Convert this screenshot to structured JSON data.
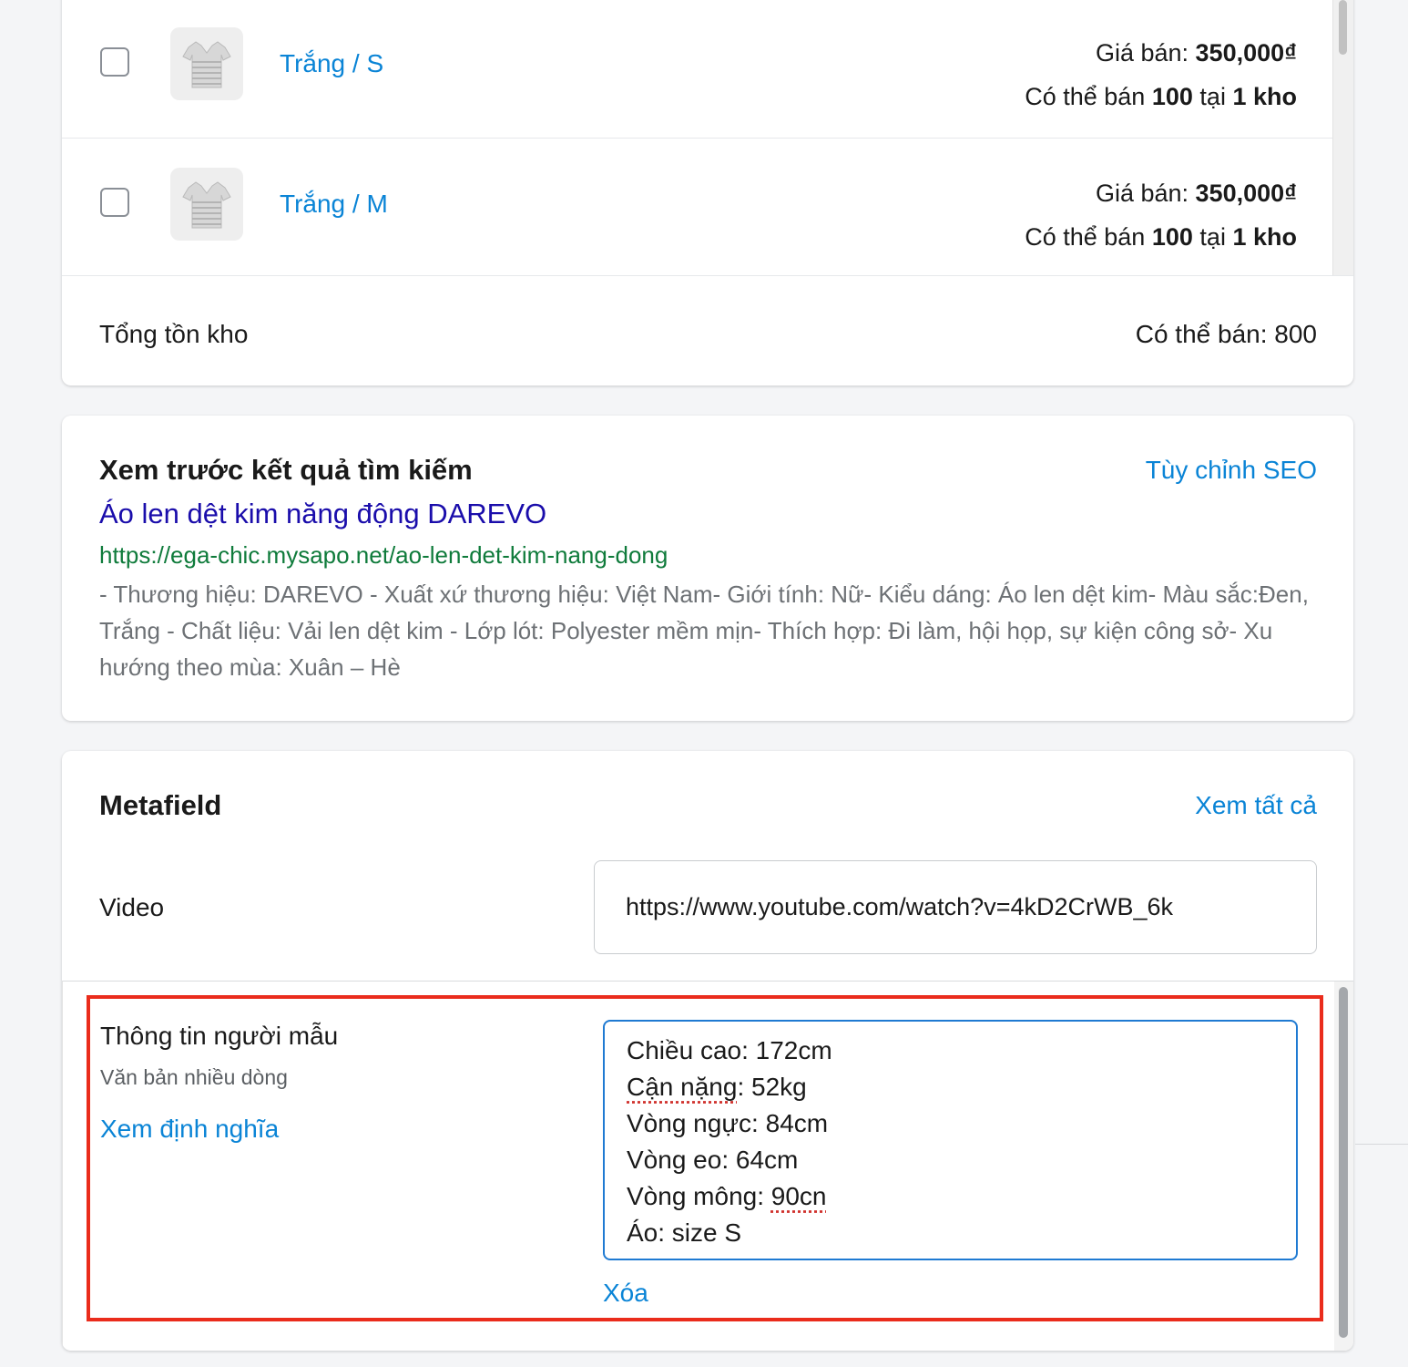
{
  "variants": [
    {
      "name": "Trắng / S",
      "price_label": "Giá bán:",
      "price": "350,000₫",
      "stock_prefix": "Có thể bán",
      "stock_qty": "100",
      "stock_mid": "tại",
      "stock_loc": "1 kho"
    },
    {
      "name": "Trắng / M",
      "price_label": "Giá bán:",
      "price": "350,000₫",
      "stock_prefix": "Có thể bán",
      "stock_qty": "100",
      "stock_mid": "tại",
      "stock_loc": "1 kho"
    }
  ],
  "inventory": {
    "total_label": "Tổng tồn kho",
    "total_value": "Có thể bán: 800"
  },
  "seo": {
    "heading": "Xem trước kết quả tìm kiếm",
    "customize_link": "Tùy chỉnh SEO",
    "title": "Áo len dệt kim năng động DAREVO",
    "url": "https://ega-chic.mysapo.net/ao-len-det-kim-nang-dong",
    "description": "- Thương hiệu: DAREVO - Xuất xứ thương hiệu: Việt Nam- Giới tính: Nữ- Kiểu dáng: Áo len dệt kim- Màu sắc:Đen, Trắng - Chất liệu: Vải len dệt kim - Lớp lót: Polyester mềm mịn- Thích hợp: Đi làm, hội họp, sự kiện công sở- Xu hướng theo mùa: Xuân – Hè"
  },
  "metafield": {
    "heading": "Metafield",
    "view_all": "Xem tất cả",
    "video_label": "Video",
    "video_value": "https://www.youtube.com/watch?v=4kD2CrWB_6k",
    "model_label": "Thông tin người mẫu",
    "model_type": "Văn bản nhiều dòng",
    "view_definition": "Xem định nghĩa",
    "model_lines": {
      "l1": "Chiều cao: 172cm",
      "l2a": "Cận nặng",
      "l2b": ": 52kg",
      "l3": "Vòng ngực: 84cm",
      "l4": "Vòng eo: 64cm",
      "l5a": "Vòng mông: ",
      "l5b": "90cn",
      "l6": "Áo: size S"
    },
    "delete_link": "Xóa"
  },
  "colors": {
    "link": "#0a84d6",
    "seo_title": "#1a0dab",
    "seo_url": "#0f7b3b",
    "highlight": "#ea2c1c"
  }
}
